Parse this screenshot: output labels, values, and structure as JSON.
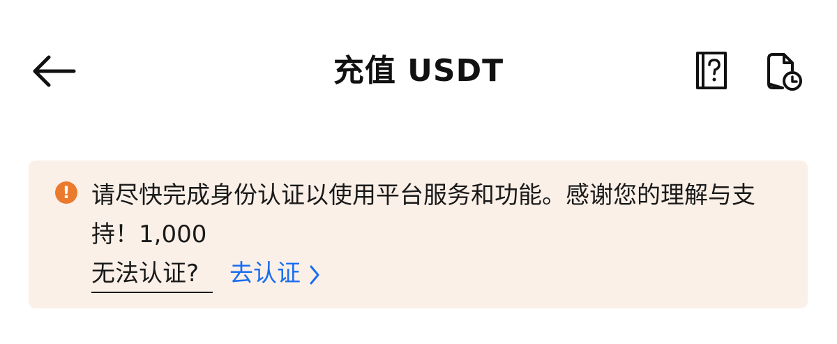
{
  "header": {
    "title": "充值 USDT"
  },
  "icons": {
    "back": "arrow-left-icon",
    "help": "help-book-icon",
    "history": "history-document-icon",
    "warning": "warning-icon"
  },
  "banner": {
    "warning_glyph": "!",
    "message": "请尽快完成身份认证以使用平台服务和功能。感谢您的理解与支持！1,000",
    "cannot_verify_label": "无法认证?",
    "verify_label": "去认证"
  },
  "colors": {
    "banner_bg": "#fbf0e8",
    "warning_orange": "#ea7a2d",
    "link_blue": "#1a6df0",
    "text": "#1a1a1a"
  }
}
